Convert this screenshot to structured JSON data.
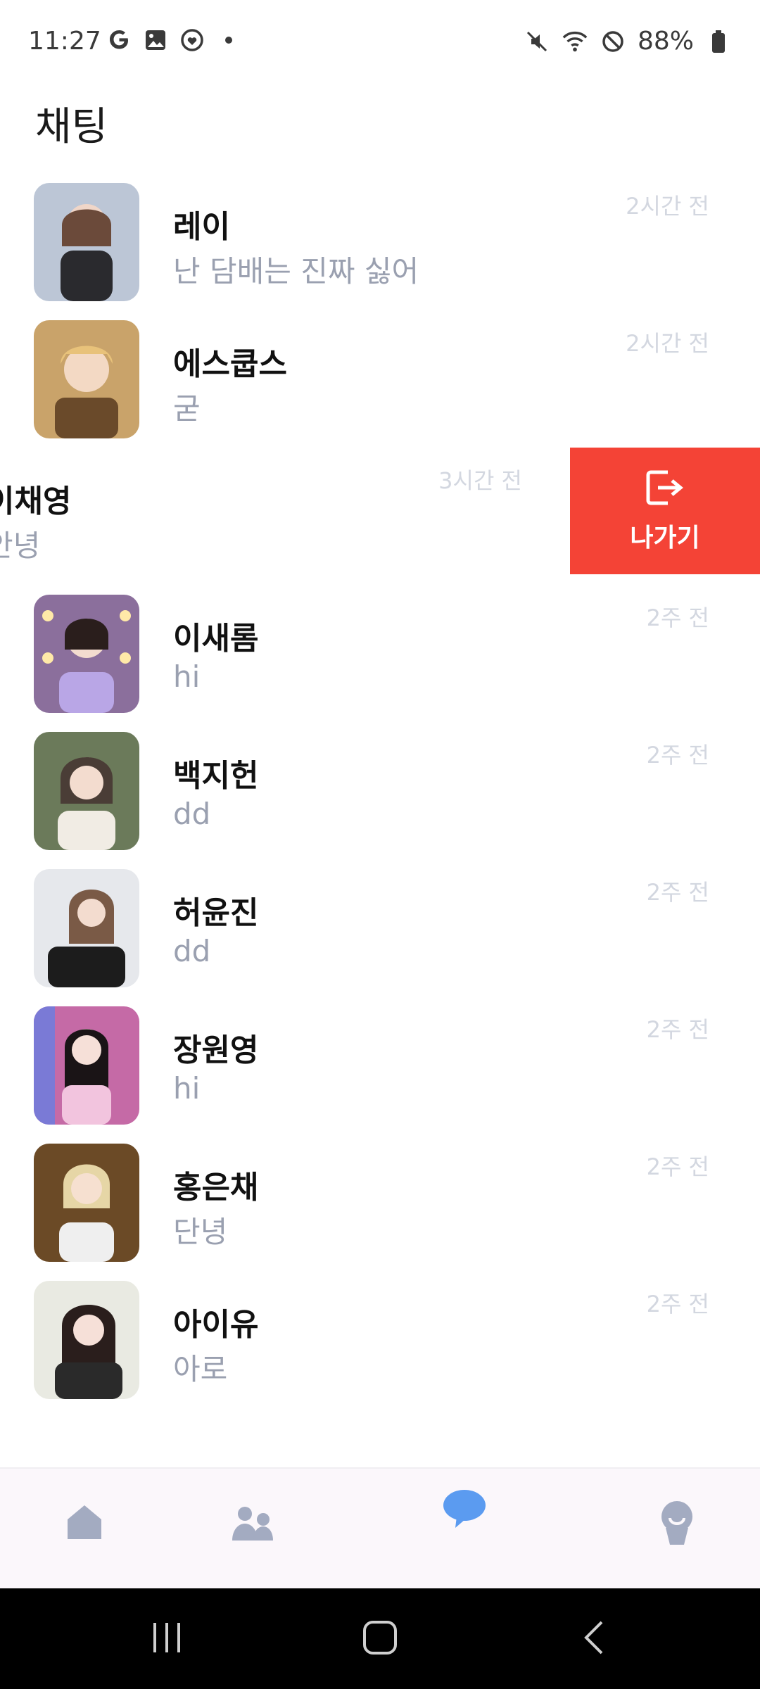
{
  "status_bar": {
    "time": "11:27",
    "left_icons": [
      "google-icon",
      "gallery-icon",
      "heart-badge-icon",
      "dot-icon"
    ],
    "right_icons": [
      "mute-icon",
      "wifi-icon",
      "block-icon"
    ],
    "battery": "88%"
  },
  "page": {
    "title": "채팅"
  },
  "chats": [
    {
      "name": "레이",
      "preview": "난 담배는 진짜 싫어",
      "time": "2시간 전",
      "avatar_colors": [
        "#bcc6d6",
        "#2a2a2e"
      ]
    },
    {
      "name": "에스쿱스",
      "preview": "굳",
      "time": "2시간 전",
      "avatar_colors": [
        "#c9a36a",
        "#6a4a2a"
      ]
    },
    {
      "name": "이채영",
      "preview": "안녕",
      "time": "3시간 전",
      "swiped": true,
      "action_label": "나가기"
    },
    {
      "name": "이새롬",
      "preview": "hi",
      "time": "2주 전",
      "avatar_colors": [
        "#b9a6e6",
        "#8b6f9c"
      ]
    },
    {
      "name": "백지헌",
      "preview": "dd",
      "time": "2주 전",
      "avatar_colors": [
        "#6b7a5a",
        "#f1ece4"
      ]
    },
    {
      "name": "허윤진",
      "preview": "dd",
      "time": "2주 전",
      "avatar_colors": [
        "#e6e8ec",
        "#1c1c1c"
      ]
    },
    {
      "name": "장원영",
      "preview": "hi",
      "time": "2주 전",
      "avatar_colors": [
        "#c56aa6",
        "#f2c4de"
      ]
    },
    {
      "name": "홍은채",
      "preview": "단녕",
      "time": "2주 전",
      "avatar_colors": [
        "#6b4a26",
        "#efefef"
      ]
    },
    {
      "name": "아이유",
      "preview": "아로",
      "time": "2주 전",
      "avatar_colors": [
        "#e9eae2",
        "#2a2a2a"
      ]
    }
  ],
  "colors": {
    "accent": "#5b9bf0",
    "leave_action": "#f44336",
    "nav_inactive": "#a3abc1",
    "muted_text": "#9aa0b0"
  },
  "bottom_nav": [
    "home-icon",
    "friends-icon",
    "chat-icon",
    "profile-icon"
  ],
  "system_nav": [
    "recent-apps-icon",
    "home-button-icon",
    "back-icon"
  ]
}
